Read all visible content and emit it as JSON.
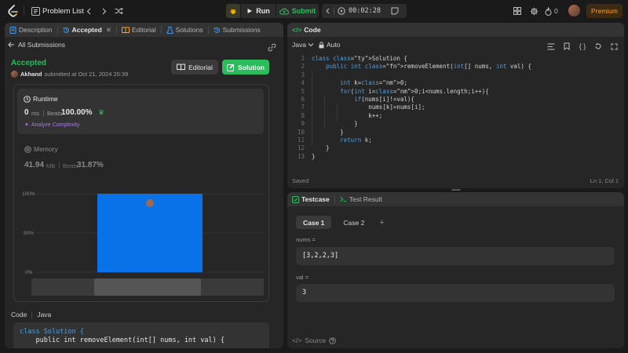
{
  "topbar": {
    "problem_list": "Problem List",
    "run": "Run",
    "submit": "Submit",
    "timer": "00:02:28",
    "streak_count": "0",
    "premium": "Premium"
  },
  "left": {
    "tabs": [
      {
        "label": "Description"
      },
      {
        "label": "Accepted"
      },
      {
        "label": "Editorial"
      },
      {
        "label": "Solutions"
      },
      {
        "label": "Submissions"
      }
    ],
    "all_submissions": "All Submissions",
    "status": "Accepted",
    "submitter": "Akhand",
    "submitted_text": "submitted at Oct 21, 2024 20:39",
    "editorial_btn": "Editorial",
    "solution_btn": "Solution",
    "runtime": {
      "title": "Runtime",
      "value": "0",
      "unit": "ms",
      "beats_label": "Beats",
      "beats_value": "100.00%",
      "analyze": "Analyze Complexity"
    },
    "memory": {
      "title": "Memory",
      "value": "41.94",
      "unit": "MB",
      "beats_label": "Beats",
      "beats_value": "31.87%"
    },
    "code_label": "Code",
    "code_lang": "Java",
    "code_preview": [
      "class Solution {",
      "    public int removeElement(int[] nums, int val) {"
    ]
  },
  "chart_data": {
    "type": "bar",
    "ytick_labels": [
      "100%",
      "50%",
      "0%"
    ],
    "ylim": [
      0,
      100
    ],
    "values": [
      100
    ],
    "bar_color": "#0a72e8",
    "grid": true
  },
  "code_panel": {
    "title": "Code",
    "language": "Java",
    "auto": "Auto",
    "saved": "Saved",
    "cursor": "Ln 1, Col 1",
    "lines": [
      "class Solution {",
      "    public int removeElement(int[] nums, int val) {",
      "",
      "        int k=0;",
      "        for(int i=0;i<nums.length;i++){",
      "            if(nums[i]!=val){",
      "                nums[k]=nums[i];",
      "                k++;",
      "            }",
      "        }",
      "        return k;",
      "    }",
      "}"
    ]
  },
  "test_panel": {
    "tab_testcase": "Testcase",
    "tab_result": "Test Result",
    "cases": [
      "Case 1",
      "Case 2"
    ],
    "inputs": [
      {
        "label": "nums =",
        "value": "[3,2,2,3]"
      },
      {
        "label": "val =",
        "value": "3"
      }
    ],
    "source": "Source"
  },
  "colors": {
    "accent_green": "#2cbb5d",
    "premium_orange": "#ffa116",
    "link_purple": "#a97de0",
    "tab_blue": "#3c9cf0"
  }
}
